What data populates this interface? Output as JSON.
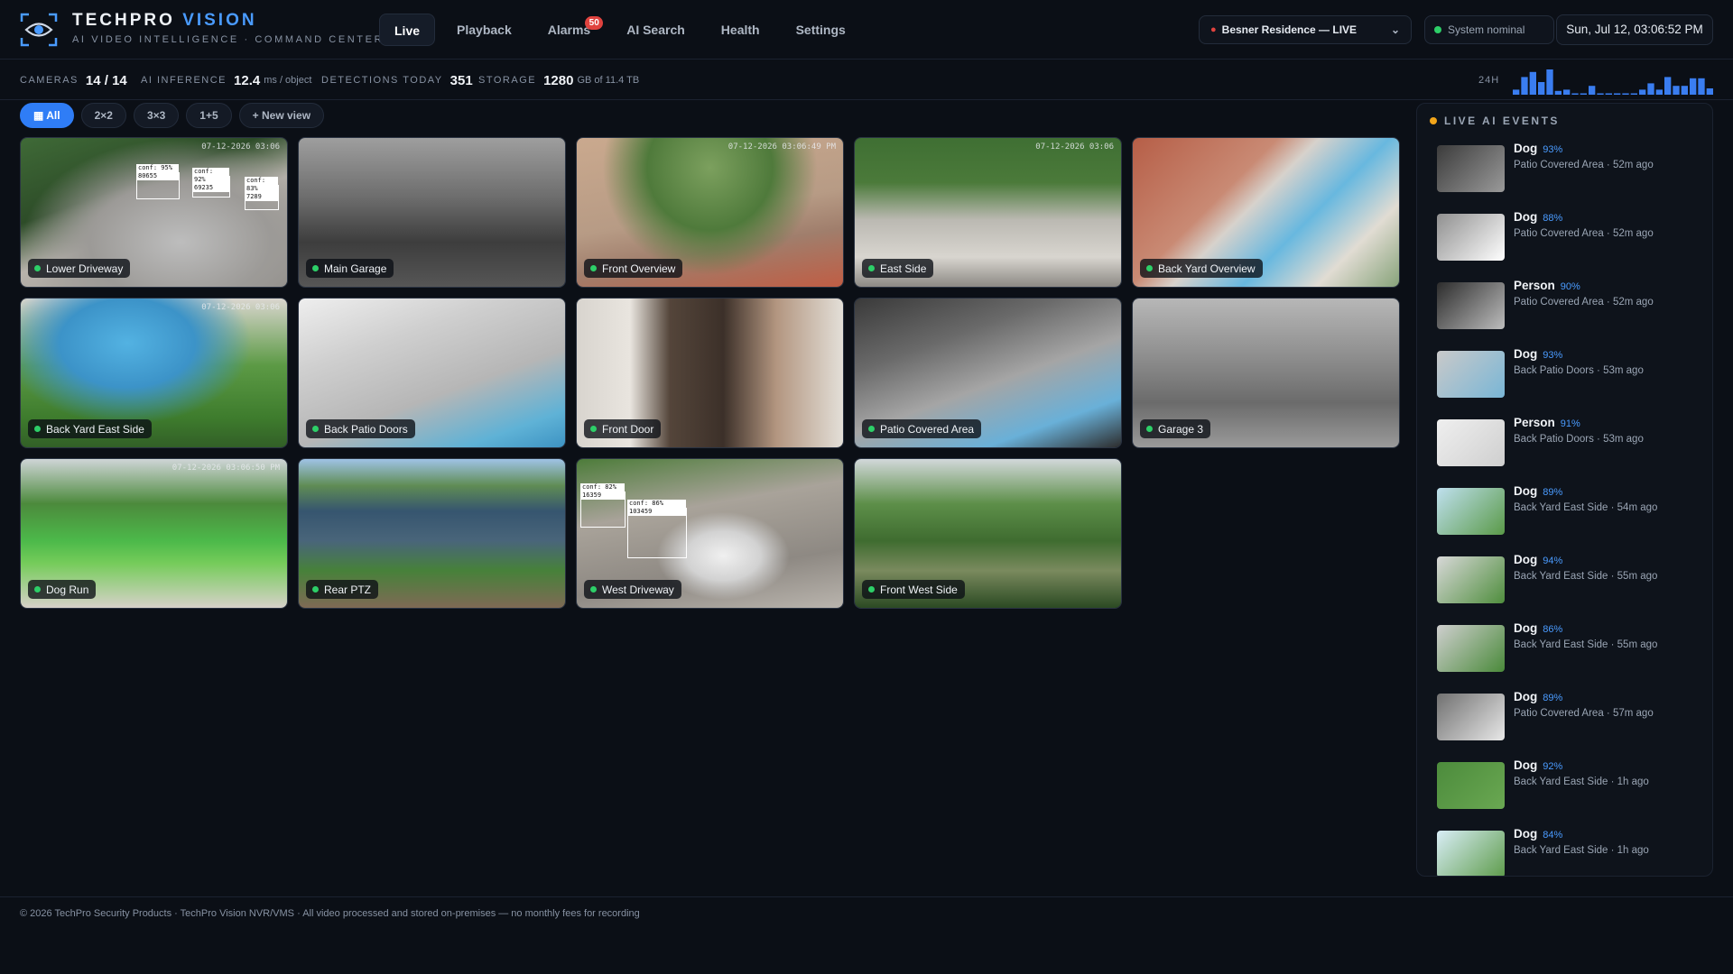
{
  "brand": {
    "name_part1": "TECHPRO",
    "name_part2": "VISION",
    "subtitle": "AI VIDEO INTELLIGENCE · COMMAND CENTER"
  },
  "nav": {
    "tabs": [
      {
        "label": "Live",
        "active": true
      },
      {
        "label": "Playback"
      },
      {
        "label": "Alarms",
        "badge": "50"
      },
      {
        "label": "AI Search"
      },
      {
        "label": "Health"
      },
      {
        "label": "Settings"
      }
    ]
  },
  "site": {
    "label": "Besner Residence — LIVE",
    "icon": "pin-icon"
  },
  "system_status": {
    "label": "System nominal",
    "color": "#2dcf68"
  },
  "clock": "Sun, Jul 12, 03:06:52 PM",
  "stats": {
    "cameras": {
      "label": "CAMERAS",
      "value": "14 / 14"
    },
    "inference": {
      "label": "AI INFERENCE",
      "value": "12.4",
      "unit": "ms / object"
    },
    "detections": {
      "label": "DETECTIONS TODAY",
      "value": "351"
    },
    "storage": {
      "label": "STORAGE",
      "value": "1280",
      "unit": "GB of 11.4 TB"
    },
    "sparkline_label": "24H",
    "sparkline_values": [
      4,
      14,
      18,
      10,
      20,
      3,
      4,
      0,
      0,
      7,
      0,
      0,
      0,
      1,
      1,
      4,
      9,
      4,
      14,
      7,
      7,
      13,
      13,
      5
    ]
  },
  "views": [
    {
      "label": "All",
      "icon": "grid-icon",
      "active": true
    },
    {
      "label": "2×2"
    },
    {
      "label": "3×3"
    },
    {
      "label": "1+5"
    },
    {
      "label": "+ New view"
    }
  ],
  "cameras": [
    {
      "name": "Lower Driveway",
      "timestamp": "07-12-2026 03:06",
      "detections": [
        "conf: 95%  80655",
        "conf: 92%  69235",
        "conf: 83%  7289"
      ]
    },
    {
      "name": "Main Garage",
      "timestamp": ""
    },
    {
      "name": "Front Overview",
      "timestamp": "07-12-2026 03:06:49 PM"
    },
    {
      "name": "East Side",
      "timestamp": "07-12-2026 03:06"
    },
    {
      "name": "Back Yard Overview",
      "timestamp": ""
    },
    {
      "name": "Back Yard East Side",
      "timestamp": "07-12-2026 03:06"
    },
    {
      "name": "Back Patio Doors",
      "timestamp": ""
    },
    {
      "name": "Front Door",
      "timestamp": ""
    },
    {
      "name": "Patio Covered Area",
      "timestamp": ""
    },
    {
      "name": "Garage 3",
      "timestamp": ""
    },
    {
      "name": "Dog Run",
      "timestamp": "07-12-2026 03:06:50 PM"
    },
    {
      "name": "Rear PTZ",
      "timestamp": ""
    },
    {
      "name": "West Driveway",
      "timestamp": "",
      "detections": [
        "conf: 82%  16359",
        "conf: 86%  103459"
      ]
    },
    {
      "name": "Front West Side",
      "timestamp": ""
    }
  ],
  "events_panel": {
    "title": "LIVE AI EVENTS",
    "events": [
      {
        "type": "Dog",
        "conf": "93%",
        "location": "Patio Covered Area",
        "time": "52m ago"
      },
      {
        "type": "Dog",
        "conf": "88%",
        "location": "Patio Covered Area",
        "time": "52m ago"
      },
      {
        "type": "Person",
        "conf": "90%",
        "location": "Patio Covered Area",
        "time": "52m ago"
      },
      {
        "type": "Dog",
        "conf": "93%",
        "location": "Back Patio Doors",
        "time": "53m ago"
      },
      {
        "type": "Person",
        "conf": "91%",
        "location": "Back Patio Doors",
        "time": "53m ago"
      },
      {
        "type": "Dog",
        "conf": "89%",
        "location": "Back Yard East Side",
        "time": "54m ago"
      },
      {
        "type": "Dog",
        "conf": "94%",
        "location": "Back Yard East Side",
        "time": "55m ago"
      },
      {
        "type": "Dog",
        "conf": "86%",
        "location": "Back Yard East Side",
        "time": "55m ago"
      },
      {
        "type": "Dog",
        "conf": "89%",
        "location": "Patio Covered Area",
        "time": "57m ago"
      },
      {
        "type": "Dog",
        "conf": "92%",
        "location": "Back Yard East Side",
        "time": "1h ago"
      },
      {
        "type": "Dog",
        "conf": "84%",
        "location": "Back Yard East Side",
        "time": "1h ago"
      }
    ]
  },
  "footer": "© 2026 TechPro Security Products · TechPro Vision NVR/VMS · All video processed and stored on-premises — no monthly fees for recording",
  "colors": {
    "accent": "#4a9bff",
    "live": "#2dcf68",
    "alarm": "#e0433f",
    "event": "#f2a51a",
    "background": "#0b0f16"
  }
}
